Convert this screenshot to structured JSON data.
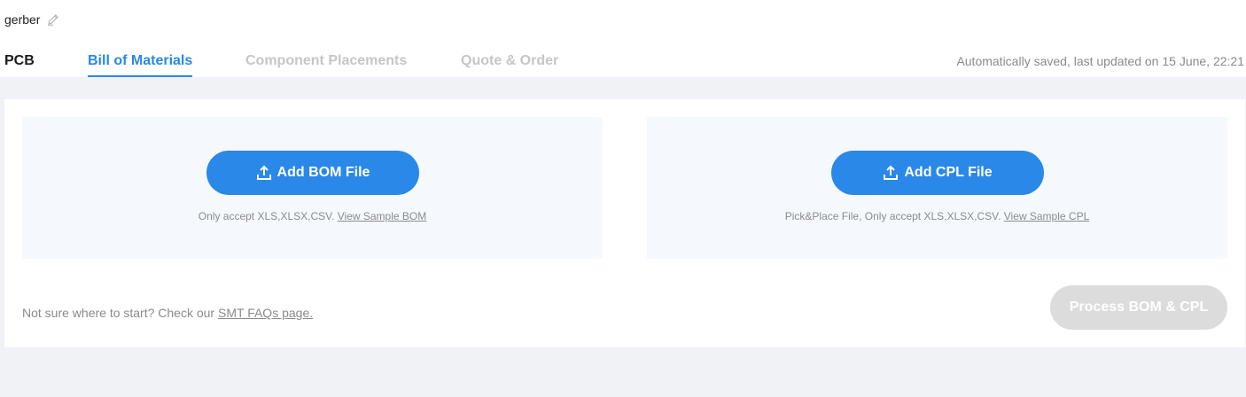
{
  "project": {
    "name": "gerber",
    "edit_icon": "pencil-icon"
  },
  "tabs": [
    {
      "label": "PCB",
      "state": "default"
    },
    {
      "label": "Bill of Materials",
      "state": "active"
    },
    {
      "label": "Component Placements",
      "state": "disabled"
    },
    {
      "label": "Quote & Order",
      "state": "disabled"
    }
  ],
  "save_status": "Automatically saved, last updated on 15 June, 22:21",
  "bom_upload": {
    "button_label": "Add BOM File",
    "icon": "upload-icon",
    "hint": "Only accept XLS,XLSX,CSV.",
    "link": "View Sample BOM"
  },
  "cpl_upload": {
    "button_label": "Add CPL File",
    "icon": "upload-icon",
    "hint": "Pick&Place File, Only accept XLS,XLSX,CSV.",
    "link": "View Sample CPL"
  },
  "help": {
    "text": "Not sure where to start? Check our ",
    "link": "SMT FAQs page."
  },
  "process_button": {
    "label": "Process BOM & CPL",
    "enabled": false
  },
  "colors": {
    "accent": "#2a88e8",
    "background": "#f1f2f5",
    "upload_area": "#f5f9fe",
    "disabled_button": "#dcdcdc",
    "muted_text": "#8a8a8a",
    "inactive_tab": "#c6c6c6"
  }
}
